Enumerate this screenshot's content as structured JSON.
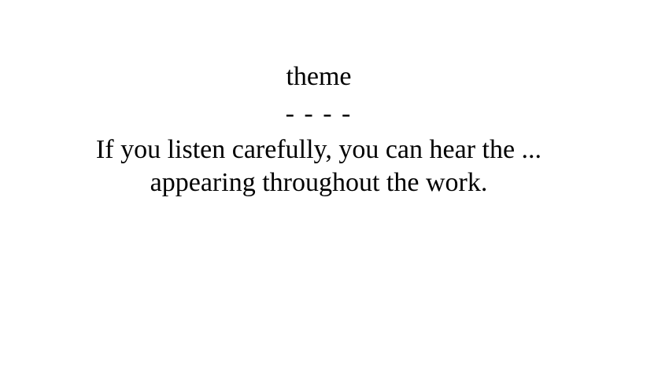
{
  "card": {
    "term": "theme",
    "separator": "- - - -",
    "definition_lines": [
      "If you listen carefully, you can hear the ...",
      "appearing throughout the work."
    ]
  }
}
